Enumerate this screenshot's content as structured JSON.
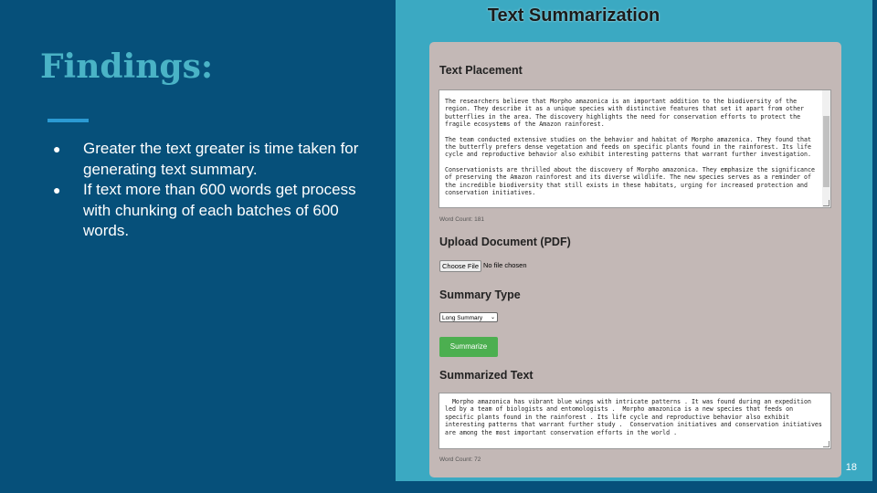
{
  "slide": {
    "title": "Findings:",
    "bullets": [
      "Greater the text greater is time taken for generating text summary.",
      "If text more than 600 words get process with chunking of each batches of 600 words."
    ],
    "page_number": "18",
    "colors": {
      "background": "#06507a",
      "title": "#4ab3c6",
      "accent": "#2b9ad3"
    }
  },
  "app": {
    "title": "Text Summarization",
    "text_placement_label": "Text Placement",
    "input_paragraphs": [
      "The researchers believe that Morpho amazonica is an important addition to the biodiversity of the region. They describe it as a unique species with distinctive features that set it apart from other butterflies in the area. The discovery highlights the need for conservation efforts to protect the fragile ecosystems of the Amazon rainforest.",
      "The team conducted extensive studies on the behavior and habitat of Morpho amazonica. They found that the butterfly prefers dense vegetation and feeds on specific plants found in the rainforest. Its life cycle and reproductive behavior also exhibit interesting patterns that warrant further investigation.",
      "Conservationists are thrilled about the discovery of Morpho amazonica. They emphasize the significance of preserving the Amazon rainforest and its diverse wildlife. The new species serves as a reminder of the incredible biodiversity that still exists in these habitats, urging for increased protection and conservation initiatives."
    ],
    "input_word_count": "Word Count: 181",
    "upload_label": "Upload Document (PDF)",
    "choose_file_button": "Choose File",
    "file_status": "No file chosen",
    "summary_type_label": "Summary Type",
    "summary_type_selected": "Long Summary",
    "summarize_button": "Summarize",
    "summarized_label": "Summarized Text",
    "summary_output": "  Morpho amazonica has vibrant blue wings with intricate patterns . It was found during an expedition led by a team of biologists and entomologists .  Morpho amazonica is a new species that feeds on specific plants found in the rainforest . Its life cycle and reproductive behavior also exhibit interesting patterns that warrant further study .  Conservation initiatives and conservation initiatives are among the most important conservation efforts in the world .",
    "summary_word_count": "Word Count: 72",
    "colors": {
      "panel": "#3ba9c2",
      "card": "#c3b8b6",
      "button": "#4caf50"
    }
  }
}
